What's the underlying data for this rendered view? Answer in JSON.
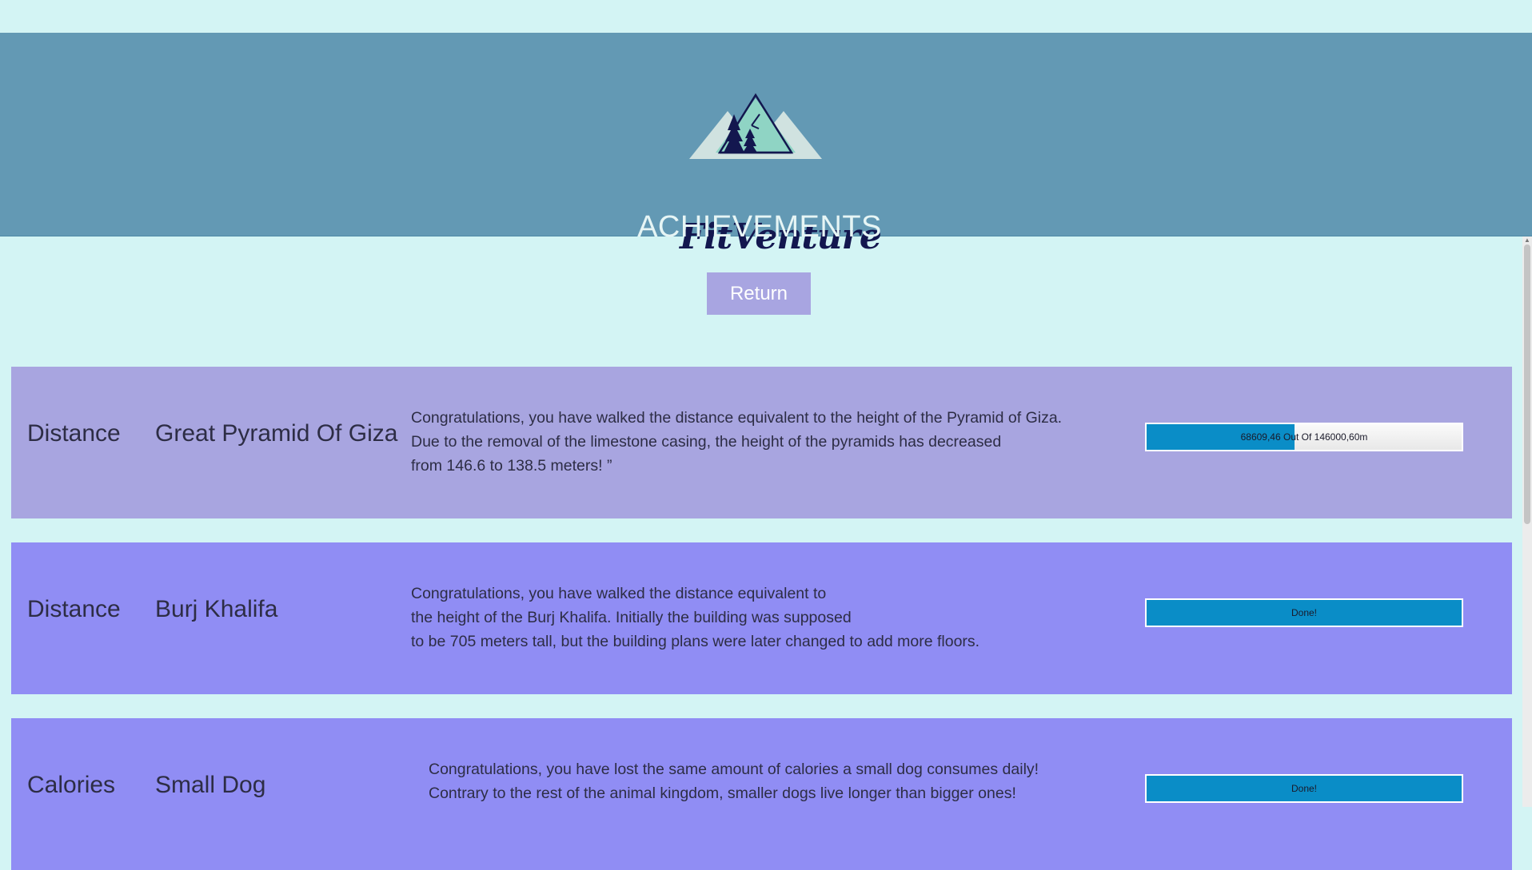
{
  "header": {
    "brand": "FitVenture",
    "page_title": "ACHIEVEMENTS",
    "logo_icon": "mountain-trees-logo"
  },
  "return_label": "Return",
  "achievements": [
    {
      "category": "Distance",
      "name": "Great Pyramid Of Giza",
      "description_lines": [
        "Congratulations, you have walked the distance equivalent to the height of the Pyramid of Giza.",
        "Due to the removal of the limestone casing, the height of the pyramids has decreased",
        "from 146.6 to 138.5 meters! ”"
      ],
      "progress_label": "68609,46 Out Of 146000,60m",
      "progress_fraction": 0.47,
      "background": "#a8a5e0"
    },
    {
      "category": "Distance",
      "name": "Burj Khalifa",
      "description_lines": [
        "Congratulations, you have walked the distance equivalent to",
        "the height of the Burj Khalifa. Initially the building was supposed",
        "to be 705 meters tall, but the building plans were later changed to add more floors."
      ],
      "progress_label": "Done!",
      "progress_fraction": 1.0,
      "background": "#908df4"
    },
    {
      "category": "Calories",
      "name": "Small Dog",
      "description_lines": [
        "Congratulations, you have lost the same amount of calories a small dog consumes daily!",
        "Contrary to the rest of the animal kingdom, smaller dogs live longer than bigger ones!"
      ],
      "progress_label": "Done!",
      "progress_fraction": 1.0,
      "background": "#908df4"
    }
  ],
  "colors": {
    "page_background": "#d3f4f4",
    "header_background": "#6399b4",
    "progress_fill": "#0a8dc7",
    "button_background": "#a8a5e1"
  }
}
